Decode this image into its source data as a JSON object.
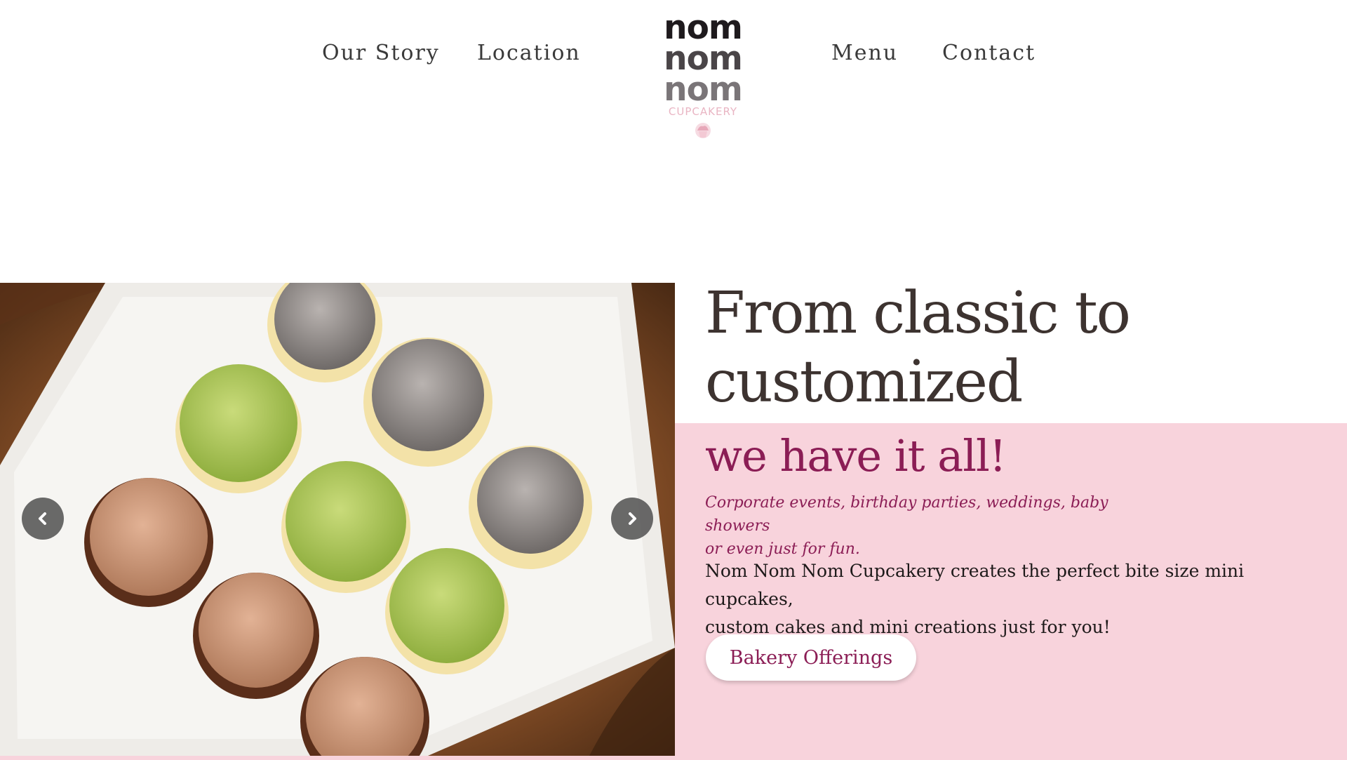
{
  "nav": {
    "left_links": [
      "Our Story",
      "Location"
    ],
    "right_links": [
      "Menu",
      "Contact"
    ]
  },
  "logo": {
    "lines": [
      "nom",
      "nom",
      "nom"
    ],
    "sub": "CUPCAKERY",
    "colors": [
      "#1e1a1d",
      "#4a4548",
      "#7a7578"
    ]
  },
  "hero": {
    "headline_line1": "From classic to",
    "headline_line2": "customized",
    "subhead": "we have it all!",
    "tagline_line1": "Corporate events, birthday parties, weddings, baby showers",
    "tagline_line2": "or even just for fun.",
    "description_line1": "Nom Nom Nom Cupcakery creates the perfect bite size mini cupcakes,",
    "description_line2": "custom cakes and mini creations just for you!",
    "cta_label": "Bakery Offerings"
  },
  "carousel": {
    "prev_icon": "chevron-left-icon",
    "next_icon": "chevron-right-icon"
  },
  "colors": {
    "accent": "#8b1d55",
    "panel": "#f8d3dc",
    "heading": "#3d3330"
  }
}
